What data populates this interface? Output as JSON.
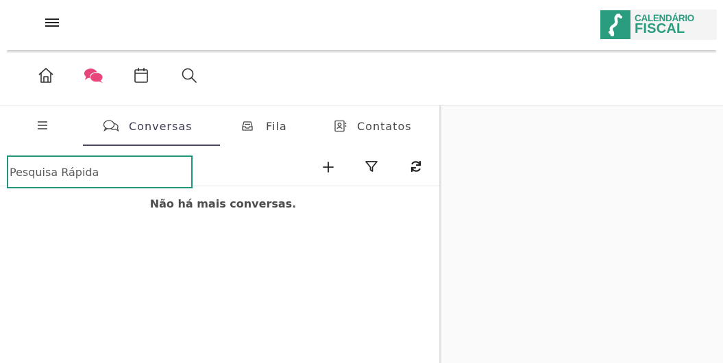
{
  "header": {
    "logo_line1": "CALENDÁRIO",
    "logo_line2": "FISCAL",
    "brand_color": "#2a9d7f"
  },
  "icon_bar": {
    "items": [
      "home-icon",
      "chat-bubbles-icon",
      "calendar-icon",
      "search-icon"
    ],
    "active_color": "#e8457a"
  },
  "tabs": [
    {
      "label": "",
      "icon": "hamburger-icon"
    },
    {
      "label": "Conversas",
      "icon": "chat-icon",
      "active": true
    },
    {
      "label": "Fila",
      "icon": "inbox-icon"
    },
    {
      "label": "Contatos",
      "icon": "contact-card-icon"
    }
  ],
  "search": {
    "placeholder": "Pesquisa Rápida",
    "value": ""
  },
  "actions": [
    "plus-icon",
    "filter-icon",
    "refresh-icon"
  ],
  "empty_state": {
    "message": "Não há mais conversas."
  }
}
